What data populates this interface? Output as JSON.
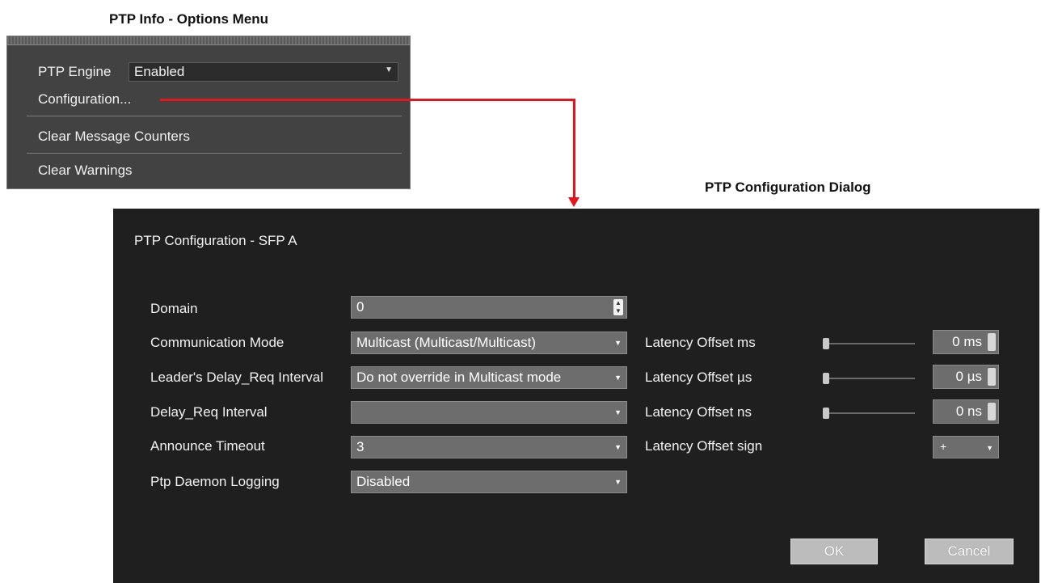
{
  "captions": {
    "options_menu": "PTP Info - Options Menu",
    "config_dialog": "PTP Configuration Dialog"
  },
  "options_menu": {
    "ptp_engine_label": "PTP Engine",
    "ptp_engine_value": "Enabled",
    "items": [
      "Configuration...",
      "Clear Message Counters",
      "Clear Warnings"
    ]
  },
  "dialog": {
    "title": "PTP Configuration - SFP A",
    "fields": [
      {
        "label": "Domain",
        "value": "0",
        "control": "spinbox"
      },
      {
        "label": "Communication Mode",
        "value": "Multicast (Multicast/Multicast)",
        "control": "dropdown"
      },
      {
        "label": "Leader's Delay_Req Interval",
        "value": "Do not override in Multicast mode",
        "control": "dropdown"
      },
      {
        "label": "Delay_Req Interval",
        "value": "",
        "control": "dropdown",
        "disabled": true
      },
      {
        "label": "Announce Timeout",
        "value": "3",
        "control": "dropdown"
      },
      {
        "label": "Ptp Daemon Logging",
        "value": "Disabled",
        "control": "dropdown"
      }
    ],
    "latency": [
      {
        "label": "Latency Offset ms",
        "value": "0 ms",
        "slider_level": 0
      },
      {
        "label": "Latency Offset µs",
        "value": "0 µs",
        "slider_level": 0
      },
      {
        "label": "Latency Offset ns",
        "value": "0 ns",
        "slider_level": 0
      }
    ],
    "sign": {
      "label": "Latency Offset sign",
      "value": "+"
    },
    "buttons": {
      "ok": "OK",
      "cancel": "Cancel"
    }
  },
  "colors": {
    "connector": "#e8141b",
    "dialog_bg": "#1f1f1f",
    "menu_bg": "#424242",
    "field_bg": "#6d6d6d"
  },
  "icons": {
    "dropdown": "chevron-down-icon",
    "spinbox": "spin-arrows-icon"
  }
}
